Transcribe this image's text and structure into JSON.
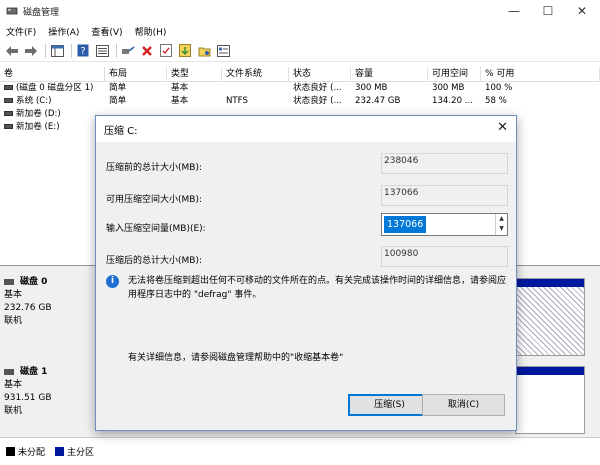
{
  "window": {
    "title": "磁盘管理",
    "controls": {
      "minimize": "—",
      "maximize": "☐",
      "close": "✕"
    }
  },
  "menu": [
    "文件(F)",
    "操作(A)",
    "查看(V)",
    "帮助(H)"
  ],
  "toolbar_icons": [
    "back-icon",
    "forward-icon",
    "console-tree-icon",
    "help-icon",
    "connect-icon",
    "delete-icon",
    "check-icon",
    "properties-icon",
    "open-icon",
    "list-icon"
  ],
  "volume_table": {
    "headers": [
      "卷",
      "布局",
      "类型",
      "文件系统",
      "状态",
      "容量",
      "可用空间",
      "% 可用"
    ],
    "rows": [
      [
        "(磁盘 0 磁盘分区 1)",
        "简单",
        "基本",
        "",
        "状态良好 (...",
        "300 MB",
        "300 MB",
        "100 %"
      ],
      [
        "系统 (C:)",
        "简单",
        "基本",
        "NTFS",
        "状态良好 (...",
        "232.47 GB",
        "134.20 ...",
        "58 %"
      ],
      [
        "新加卷 (D:)",
        "",
        "",
        "",
        "",
        "",
        "",
        ""
      ],
      [
        "新加卷 (E:)",
        "",
        "",
        "",
        "",
        "",
        "",
        ""
      ]
    ]
  },
  "disks": [
    {
      "name": "磁盘 0",
      "type": "基本",
      "size": "232.76 GB",
      "status": "联机"
    },
    {
      "name": "磁盘 1",
      "type": "基本",
      "size": "931.51 GB",
      "status": "联机"
    }
  ],
  "legend": [
    {
      "label": "未分配",
      "color": "#000000"
    },
    {
      "label": "主分区",
      "color": "#00189e"
    }
  ],
  "dialog": {
    "title": "压缩 C:",
    "close": "✕",
    "fields": {
      "total_before_label": "压缩前的总计大小(MB):",
      "total_before_value": "238046",
      "available_label": "可用压缩空间大小(MB):",
      "available_value": "137066",
      "input_label": "输入压缩空间量(MB)(E):",
      "input_value": "137066",
      "total_after_label": "压缩后的总计大小(MB):",
      "total_after_value": "100980"
    },
    "info_text": "无法将卷压缩到超出任何不可移动的文件所在的点。有关完成该操作时间的详细信息，请参阅应用程序日志中的 \"defrag\" 事件。",
    "help_text": "有关详细信息，请参阅磁盘管理帮助中的\"收缩基本卷\"",
    "buttons": {
      "ok": "压缩(S)",
      "cancel": "取消(C)"
    }
  }
}
